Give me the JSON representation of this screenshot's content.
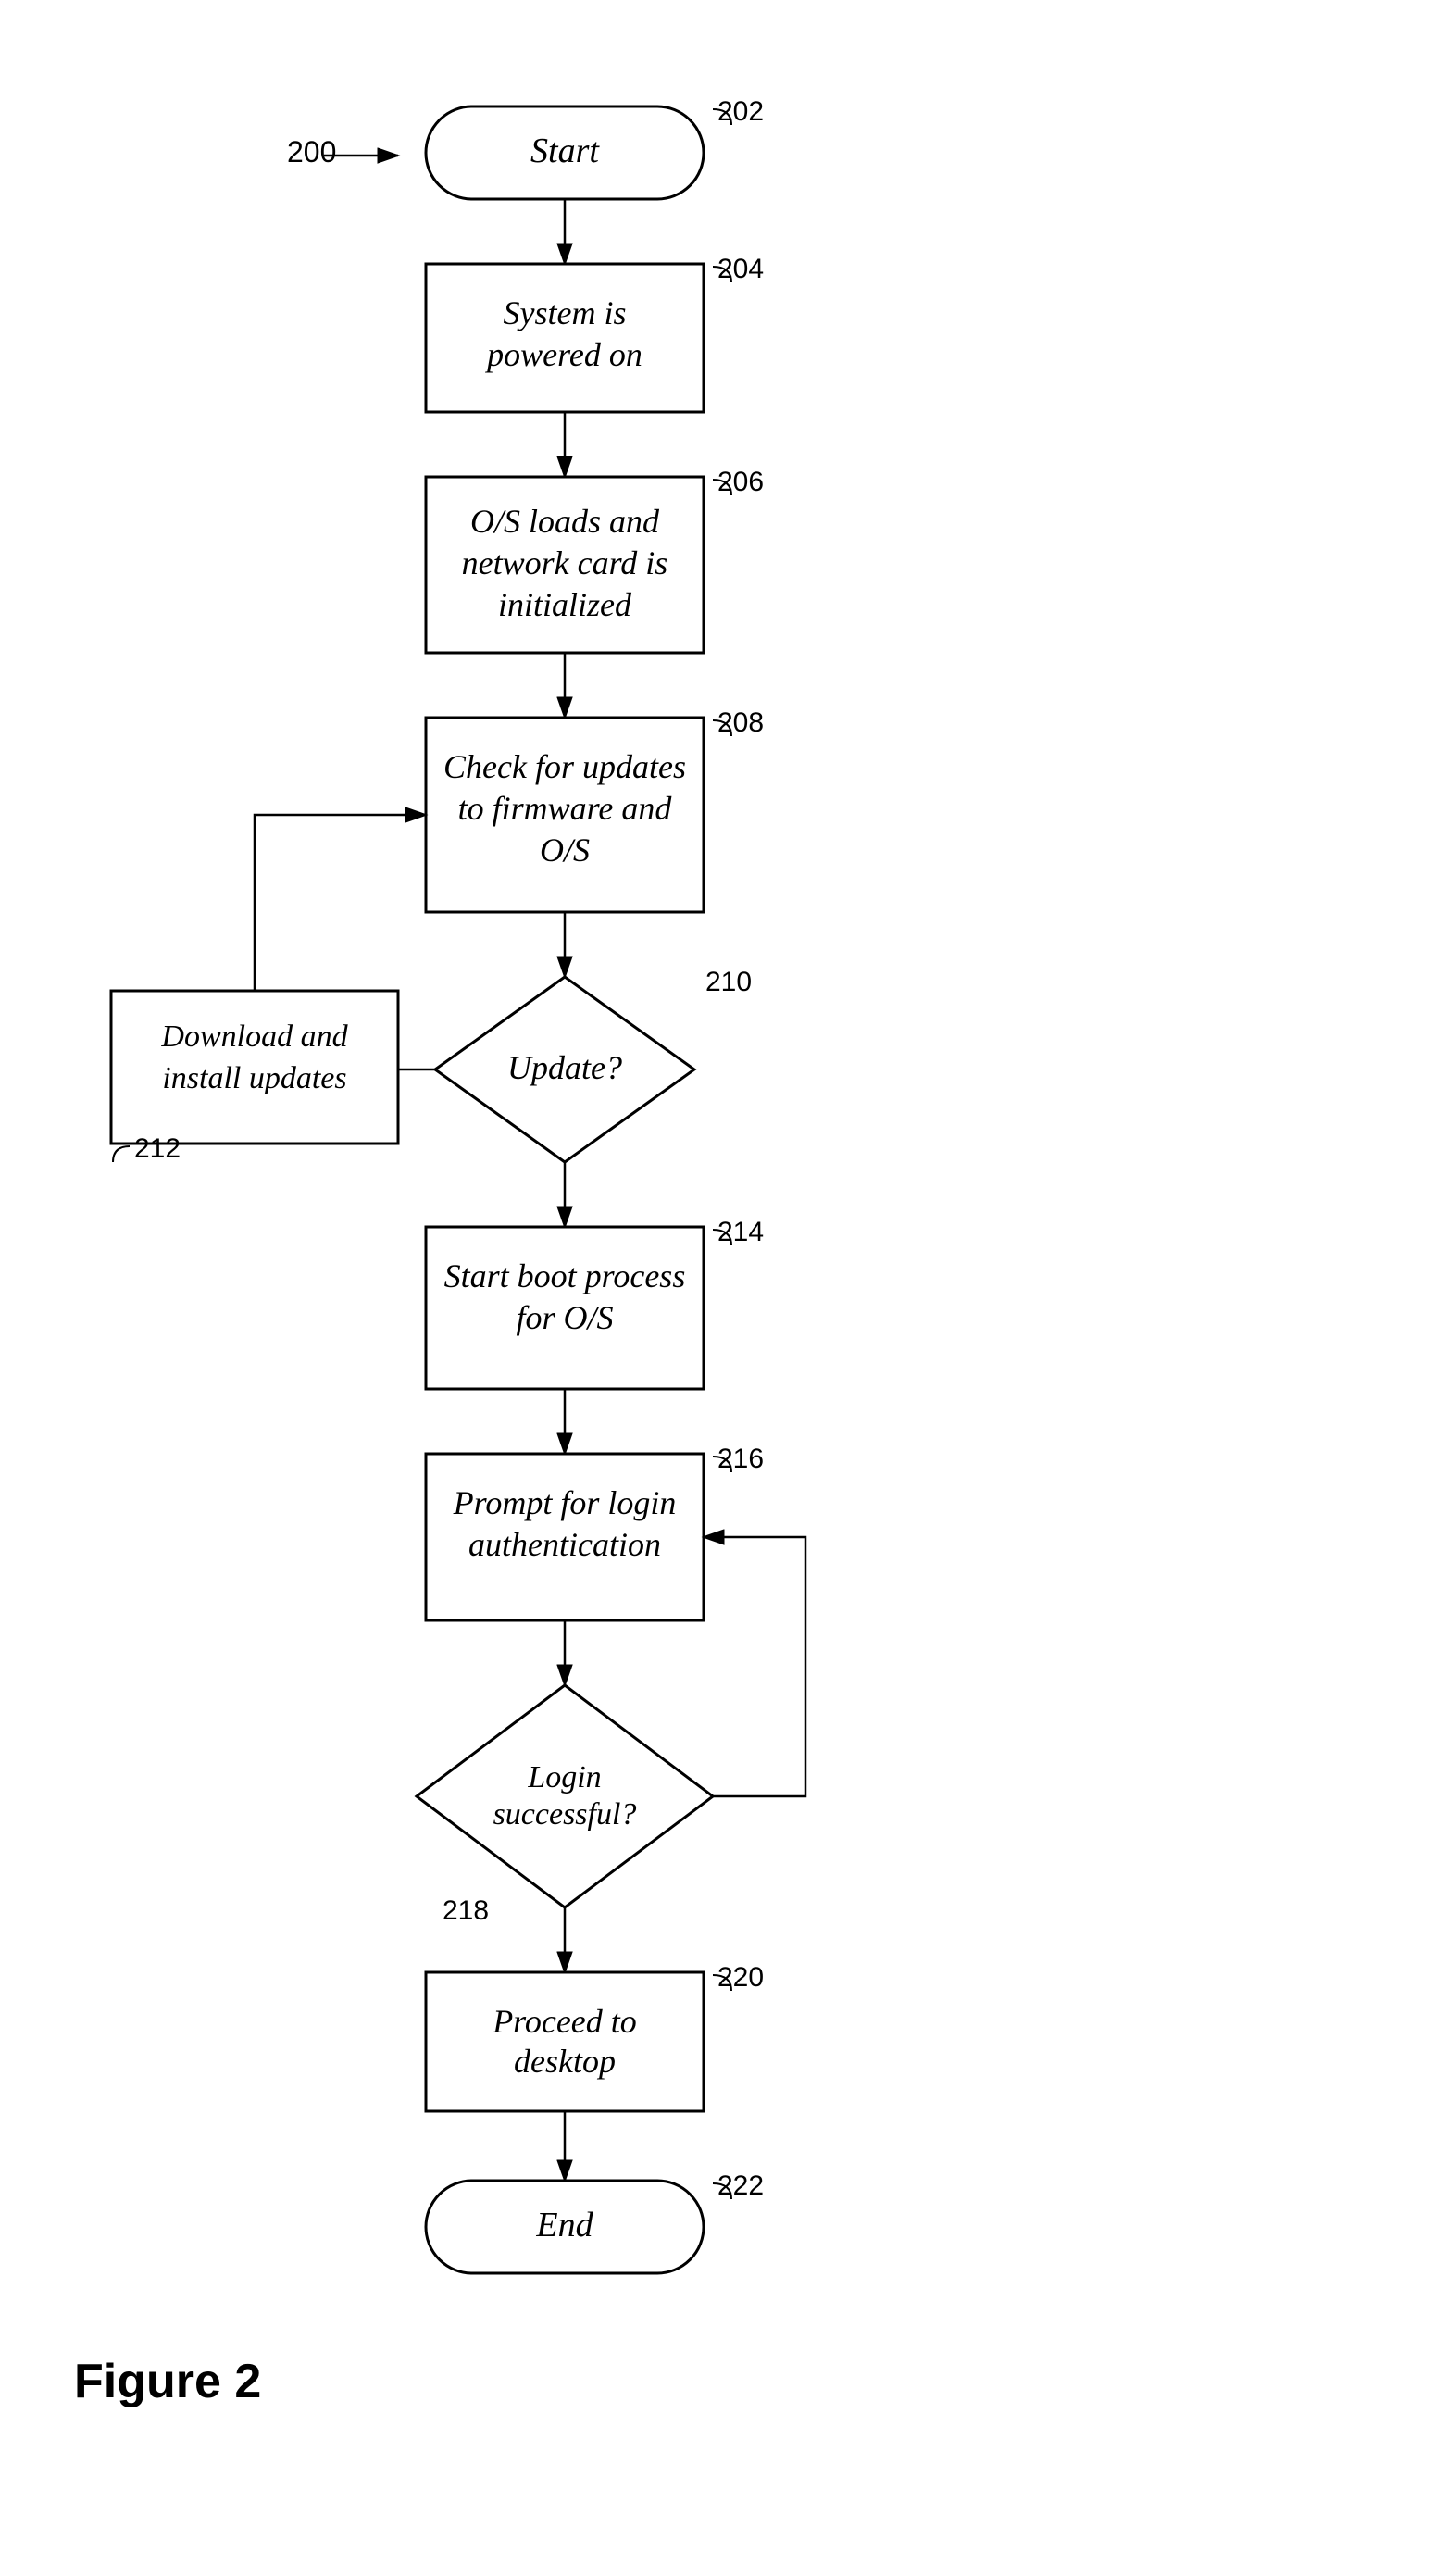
{
  "figure": {
    "label": "Figure 2",
    "diagram_ref": "200",
    "nodes": {
      "start": {
        "label": "Start",
        "id": "202"
      },
      "powered_on": {
        "label": "System is powered on",
        "id": "204"
      },
      "os_loads": {
        "label": "O/S loads and network card is initialized",
        "id": "206"
      },
      "check_updates": {
        "label": "Check for updates to firmware and O/S",
        "id": "208"
      },
      "update_decision": {
        "label": "Update?",
        "id": "210"
      },
      "download_install": {
        "label": "Download and install updates",
        "id": "212"
      },
      "boot_process": {
        "label": "Start boot process for O/S",
        "id": "214"
      },
      "prompt_login": {
        "label": "Prompt for login authentication",
        "id": "216"
      },
      "login_decision": {
        "label": "Login successful?",
        "id": "218"
      },
      "proceed_desktop": {
        "label": "Proceed to desktop",
        "id": "220"
      },
      "end": {
        "label": "End",
        "id": "222"
      }
    }
  }
}
